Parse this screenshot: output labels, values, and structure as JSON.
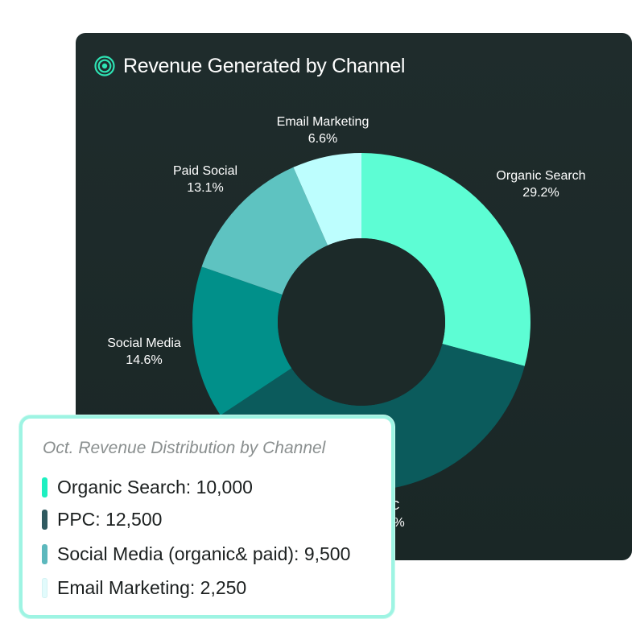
{
  "card": {
    "title": "Revenue Generated by Channel",
    "icon": "concentric-circles-icon"
  },
  "chart_data": {
    "type": "pie",
    "donut": true,
    "slices": [
      {
        "label": "Organic Search",
        "percent": 29.2,
        "percent_label": "29.2%",
        "color": "#5dfdd4"
      },
      {
        "label": "PPC",
        "percent": 36.5,
        "percent_label": "36.5%",
        "color": "#0b5b5c"
      },
      {
        "label": "Social Media",
        "percent": 14.6,
        "percent_label": "14.6%",
        "color": "#01908a"
      },
      {
        "label": "Paid Social",
        "percent": 13.1,
        "percent_label": "13.1%",
        "color": "#5ec3c1"
      },
      {
        "label": "Email Marketing",
        "percent": 6.6,
        "percent_label": "6.6%",
        "color": "#bdfefe"
      }
    ]
  },
  "tooltip": {
    "title": "Oct. Revenue Distribution by Channel",
    "items": [
      {
        "text": "Organic Search: 10,000",
        "color": "#1ef0c1"
      },
      {
        "text": "PPC: 12,500",
        "color": "#2f5a60"
      },
      {
        "text": "Social Media (organic& paid): 9,500",
        "color": "#5cb8bd"
      },
      {
        "text": "Email Marketing: 2,250",
        "color": "#e2fbfc"
      }
    ]
  }
}
